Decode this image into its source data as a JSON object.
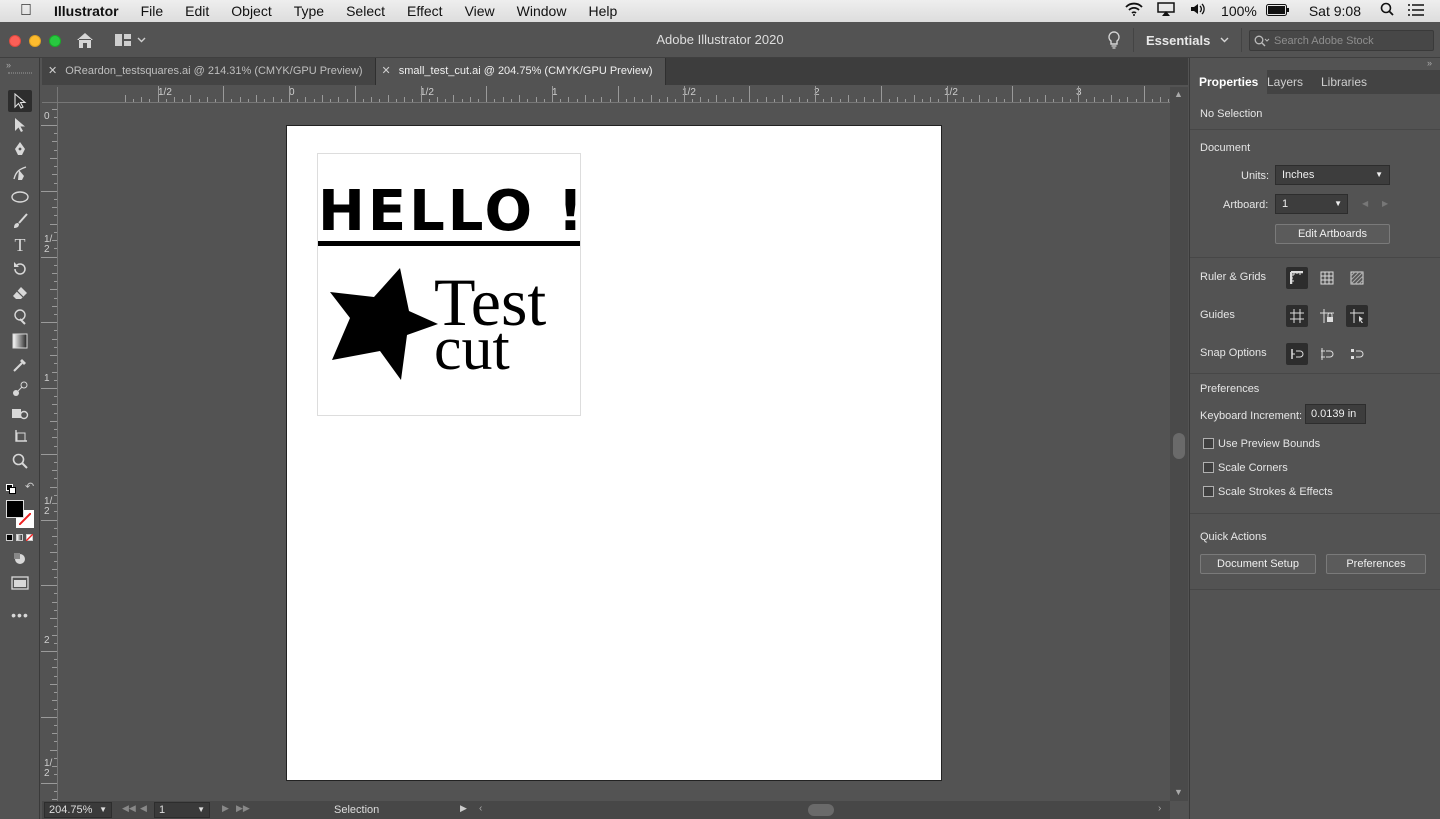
{
  "menubar": {
    "app": "Illustrator",
    "menus": [
      "File",
      "Edit",
      "Object",
      "Type",
      "Select",
      "Effect",
      "View",
      "Window",
      "Help"
    ],
    "battery": "100%",
    "clock": "Sat 9:08"
  },
  "titlebar": {
    "title": "Adobe Illustrator 2020",
    "workspace": "Essentials",
    "search_placeholder": "Search Adobe Stock"
  },
  "tabs": [
    {
      "label": "OReardon_testsquares.ai @ 214.31% (CMYK/GPU Preview)",
      "active": false
    },
    {
      "label": "small_test_cut.ai @ 204.75% (CMYK/GPU Preview)",
      "active": true
    }
  ],
  "rulers": {
    "h_labels": [
      "1/2",
      "0",
      "1/2",
      "1",
      "1/2",
      "2",
      "1/2",
      "3"
    ],
    "v_labels": [
      "0",
      "1/2",
      "1",
      "1/2",
      "2",
      "1/2"
    ]
  },
  "artwork": {
    "hello": "HELLO !",
    "test": "Test",
    "cut": "cut"
  },
  "statusbar": {
    "zoom": "204.75%",
    "artboard": "1",
    "tool": "Selection"
  },
  "panel": {
    "tabs": [
      "Properties",
      "Layers",
      "Libraries"
    ],
    "selection": "No Selection",
    "document_heading": "Document",
    "units_label": "Units:",
    "units_value": "Inches",
    "artboard_label": "Artboard:",
    "artboard_value": "1",
    "edit_artboards": "Edit Artboards",
    "ruler_grids": "Ruler & Grids",
    "guides": "Guides",
    "snap_options": "Snap Options",
    "preferences_heading": "Preferences",
    "keyboard_increment_label": "Keyboard Increment:",
    "keyboard_increment_value": "0.0139 in",
    "use_preview_bounds": "Use Preview Bounds",
    "scale_corners": "Scale Corners",
    "scale_strokes": "Scale Strokes & Effects",
    "quick_actions": "Quick Actions",
    "document_setup": "Document Setup",
    "preferences_button": "Preferences"
  }
}
